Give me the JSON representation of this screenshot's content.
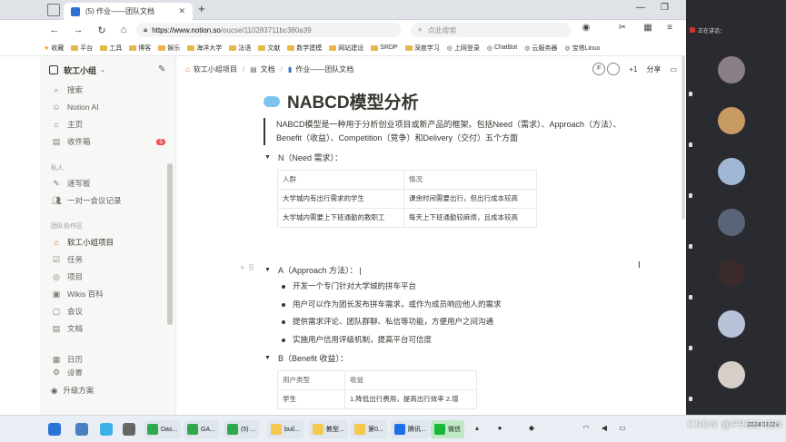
{
  "browser": {
    "tab_title": "(5) 作业——团队文档",
    "url_main": "https://www.notion.so",
    "url_rest": "/oucse/110283711bc380a39",
    "search_placeholder": "点此搜索",
    "bookmarks": [
      "收藏",
      "平台",
      "工具",
      "博客",
      "娱乐",
      "海洋大学",
      "法语",
      "文献",
      "数学建模",
      "网站建设",
      "SRDP",
      "深度学习",
      "上网登录",
      "ChatBot",
      "云服务器",
      "宝塔Linux"
    ]
  },
  "sidebar": {
    "workspace": "软工小组",
    "items": [
      {
        "label": "搜索",
        "icon": "search-icon"
      },
      {
        "label": "Notion AI",
        "icon": "ai-face-icon"
      },
      {
        "label": "主页",
        "icon": "home-icon"
      },
      {
        "label": "收件箱",
        "icon": "inbox-icon",
        "badge": "5"
      }
    ],
    "private_header": "私人",
    "private_items": [
      {
        "label": "速写板",
        "icon": "pen-icon"
      },
      {
        "label": "一对一会议记录",
        "icon": "people-icon"
      }
    ],
    "team_header": "团队协作区",
    "team_items": [
      {
        "label": "软工小组项目",
        "icon": "house-icon"
      },
      {
        "label": "任务",
        "icon": "check-icon"
      },
      {
        "label": "项目",
        "icon": "target-icon"
      },
      {
        "label": "Wikis 百科",
        "icon": "book-icon"
      },
      {
        "label": "会议",
        "icon": "meeting-icon"
      },
      {
        "label": "文档",
        "icon": "doc-icon"
      },
      {
        "label": "日历",
        "icon": "calendar-icon"
      },
      {
        "label": "设置",
        "icon": "gear-icon"
      }
    ],
    "upgrade": "升级方案"
  },
  "topbar": {
    "crumbs": [
      "软工小组项目",
      "文档",
      "作业——团队文档"
    ],
    "collab_count": "+1",
    "share": "分享"
  },
  "page": {
    "title": "NABCD模型分析",
    "quote": "NABCD模型是一种用于分析创业项目或新产品的框架。包括Need（需求）、Approach（方法）、Benefit（收益）、Competition（竞争）和Delivery（交付）五个方面",
    "need_heading": "N（Need 需求）：",
    "need_table": [
      [
        "人群",
        "情况"
      ],
      [
        "大学城内有出行需求的学生",
        "课余时间需要出行，但出行成本较高"
      ],
      [
        "大学城内需要上下班通勤的教职工",
        "每天上下班通勤较麻烦，且成本较高"
      ]
    ],
    "approach_heading": "A（Approach 方法）：",
    "approach_bullets": [
      "开发一个专门针对大学城的拼车平台",
      "用户可以作为团长发布拼车需求，或作为成员响应他人的需求",
      "提供需求评论、团队群聊、私信等功能，方便用户之间沟通",
      "实施用户信用评级机制，提高平台可信度"
    ],
    "benefit_heading": "B（Benefit 收益）：",
    "benefit_table": [
      [
        "用户类型",
        "收益"
      ],
      [
        "学生",
        "1.降低出行费用，提高出行效率 2.增"
      ]
    ]
  },
  "meeting": {
    "header": "正在讲话："
  },
  "taskbar": {
    "apps": [
      "Das...",
      "GA...",
      "(5) ...",
      "buil...",
      "教型...",
      "第0...",
      "腾讯...",
      "微信"
    ],
    "time": "2024/10/29"
  },
  "watermark": "CSDN @FREEHEN",
  "colors": {
    "accent": "#2f6fd1",
    "badge": "#eb5757",
    "sidebar_bg": "#f7f7f5",
    "meeting_bg": "#2a2b30"
  }
}
